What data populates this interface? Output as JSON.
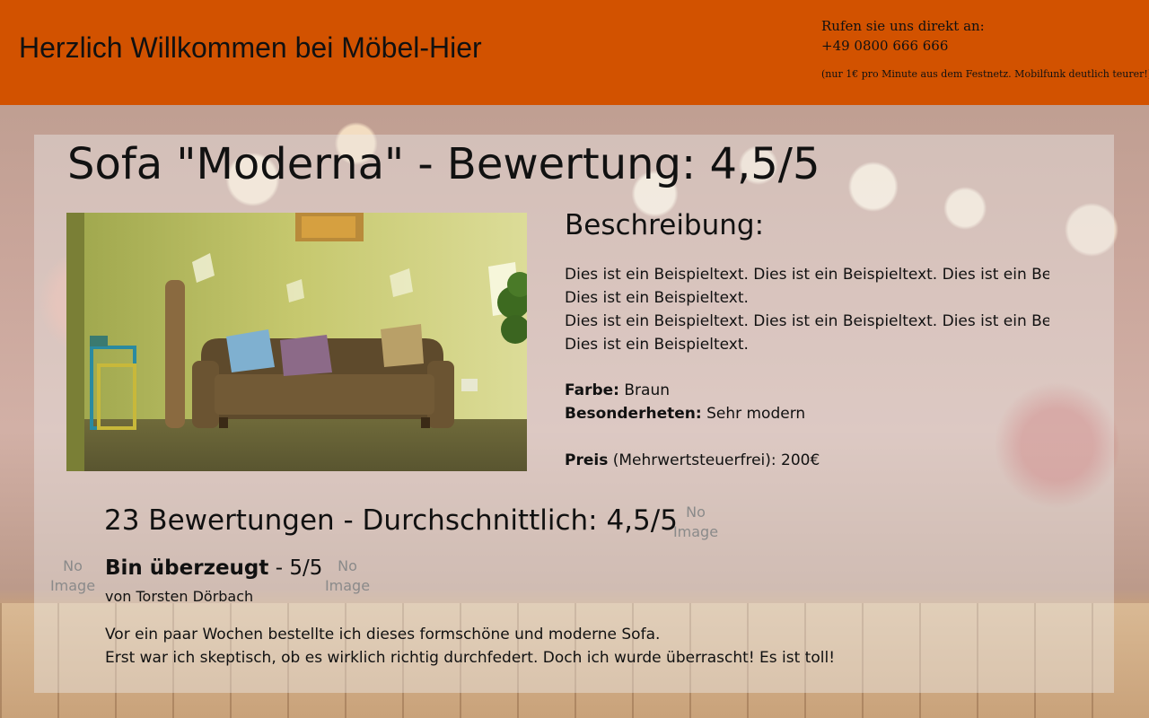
{
  "header": {
    "title": "Herzlich Willkommen bei Möbel-Hier",
    "contact": {
      "call_label": "Rufen sie uns direkt an:",
      "phone": "+49 0800 666 666",
      "note": "(nur 1€ pro Minute aus dem Festnetz. Mobilfunk deutlich teurer!)"
    }
  },
  "product": {
    "title": "Sofa \"Moderna\" - Bewertung: 4,5/5",
    "description_heading": "Beschreibung:",
    "description_lines": [
      "Dies ist ein Beispieltext. Dies ist ein Beispieltext. Dies ist ein Bei",
      "Dies ist ein Beispieltext.",
      "Dies ist ein Beispieltext. Dies ist ein Beispieltext. Dies ist ein Bei",
      "Dies ist ein Beispieltext."
    ],
    "color_label": "Farbe:",
    "color_value": "Braun",
    "features_label": "Besonderheten:",
    "features_value": "Sehr modern",
    "price_label": "Preis",
    "price_value": "(Mehrwertsteuerfrei): 200€"
  },
  "reviews": {
    "heading": "23 Bewertungen - Durchschnittlich: 4,5/5",
    "no_image_text": "No Image",
    "items": [
      {
        "title": "Bin überzeugt",
        "rating": "- 5/5",
        "author": "von Torsten Dörbach",
        "body_lines": [
          "Vor ein paar Wochen bestellte ich dieses formschöne und moderne Sofa.",
          "Erst war ich skeptisch, ob es wirklich richtig durchfedert. Doch ich wurde überrascht! Es ist toll!"
        ]
      }
    ]
  }
}
